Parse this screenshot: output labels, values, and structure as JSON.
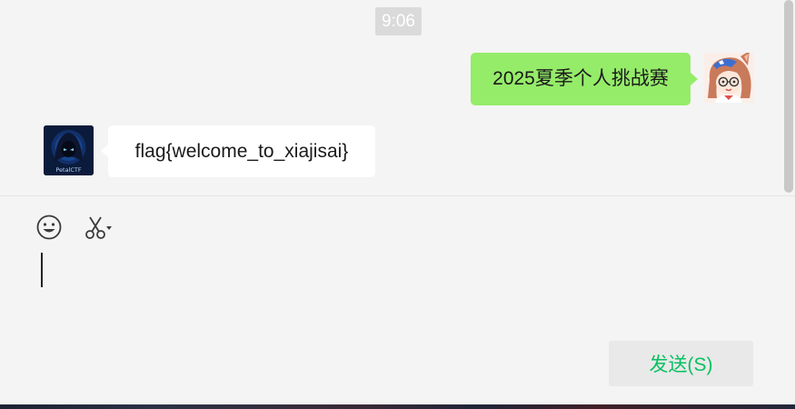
{
  "chat": {
    "timestamp": "9:06",
    "messages": [
      {
        "direction": "outgoing",
        "text": "2025夏季个人挑战赛",
        "sender": "me"
      },
      {
        "direction": "incoming",
        "text": "flag{welcome_to_xiajisai}",
        "sender": "contact"
      }
    ],
    "contact_avatar_text": "PetalCTF"
  },
  "composer": {
    "value": "",
    "send_label": "发送(S)",
    "tools": [
      "emoji-icon",
      "scissors-icon"
    ]
  },
  "colors": {
    "outgoing_bubble": "#95ec69",
    "incoming_bubble": "#ffffff",
    "send_text": "#07c160",
    "background": "#f4f4f4"
  }
}
